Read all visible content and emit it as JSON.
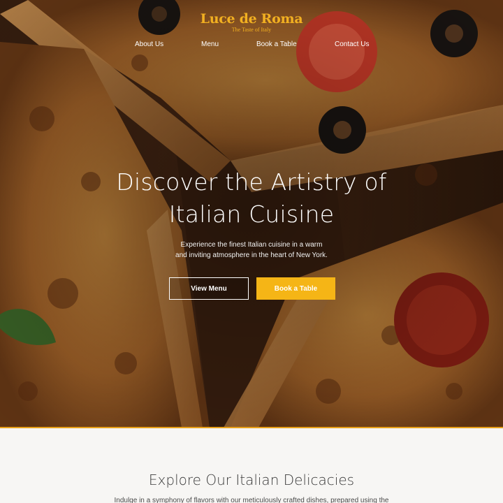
{
  "header": {
    "brand_name": "Luce de Roma",
    "brand_tagline": "The Taste of Italy",
    "nav": [
      {
        "label": "About Us"
      },
      {
        "label": "Menu"
      },
      {
        "label": "Book a Table"
      },
      {
        "label": "Contact Us"
      }
    ]
  },
  "hero": {
    "title_line1": "Discover the Artistry of",
    "title_line2": "Italian Cuisine",
    "subtitle_line1": "Experience the finest Italian cuisine in a warm",
    "subtitle_line2": "and inviting atmosphere in the heart of New York.",
    "view_menu_label": "View Menu",
    "book_table_label": "Book a Table",
    "background": "pizza-photo"
  },
  "section": {
    "title": "Explore Our Italian Delicacies",
    "text": "Indulge in a symphony of flavors with our meticulously crafted dishes, prepared using the"
  },
  "colors": {
    "accent": "#f5b516",
    "brand": "#f2b021",
    "page_background": "#f7f6f4"
  }
}
